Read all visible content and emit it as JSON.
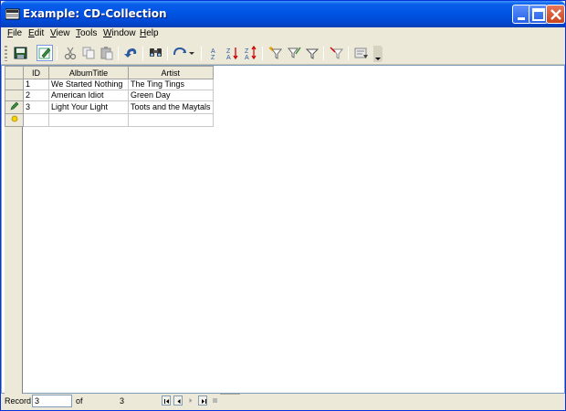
{
  "window": {
    "title": "Example: CD-Collection"
  },
  "menu": {
    "items": [
      {
        "accel": "F",
        "rest": "ile"
      },
      {
        "accel": "E",
        "rest": "dit"
      },
      {
        "accel": "V",
        "rest": "iew"
      },
      {
        "accel": "T",
        "rest": "ools"
      },
      {
        "accel": "W",
        "rest": "indow"
      },
      {
        "accel": "H",
        "rest": "elp"
      }
    ]
  },
  "toolbar": {
    "icons": [
      "save-record-icon",
      "edit-data-icon",
      "cut-icon",
      "copy-icon",
      "paste-icon",
      "undo-icon",
      "find-record-icon",
      "refresh-icon",
      "sort-ascending-icon",
      "sort-descending-icon",
      "sort-icon",
      "autofilter-icon",
      "standard-filter-icon",
      "apply-filter-icon",
      "remove-filter-icon",
      "data-to-text-icon"
    ]
  },
  "grid": {
    "columns": [
      "ID",
      "AlbumTitle",
      "Artist"
    ],
    "rows": [
      {
        "id": "1",
        "title": "We Started Nothing",
        "artist": "The Ting Tings",
        "marker": ""
      },
      {
        "id": "2",
        "title": "American Idiot",
        "artist": "Green Day",
        "marker": ""
      },
      {
        "id": "3",
        "title": "Light Your Light",
        "artist": "Toots and the Maytals",
        "marker": "pencil-icon"
      }
    ],
    "new_row_marker": "new-record-icon"
  },
  "navigation": {
    "record_label": "Record",
    "current_record": "3",
    "of_label": "of",
    "total_records": "3"
  },
  "colors": {
    "titlebar": "#0055e5",
    "chrome": "#ece9d8",
    "grid_border": "#7f9db9"
  }
}
